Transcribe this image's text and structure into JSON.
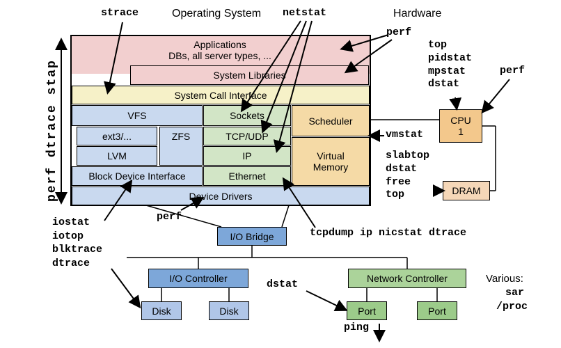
{
  "headers": {
    "os": "Operating System",
    "hardware": "Hardware"
  },
  "os_stack": {
    "apps_line1": "Applications",
    "apps_line2": "DBs, all server types, ...",
    "syslibs": "System Libraries",
    "syscall": "System Call Interface",
    "vfs": "VFS",
    "ext3": "ext3/...",
    "zfs": "ZFS",
    "lvm": "LVM",
    "bdi": "Block Device Interface",
    "sockets": "Sockets",
    "tcpudp": "TCP/UDP",
    "ip": "IP",
    "ethernet": "Ethernet",
    "scheduler": "Scheduler",
    "vmem_line1": "Virtual",
    "vmem_line2": "Memory",
    "device_drivers": "Device Drivers"
  },
  "hardware": {
    "cpu_label": "CPU",
    "cpu_num": "1",
    "dram": "DRAM",
    "iobridge": "I/O Bridge",
    "ioctrl": "I/O Controller",
    "netctrl": "Network Controller",
    "disk": "Disk",
    "port": "Port"
  },
  "tools": {
    "left_vertical": "perf dtrace stap",
    "strace": "strace",
    "netstat": "netstat",
    "perf_top": "perf",
    "top_right_lines": "top\npidstat\nmpstat\ndstat",
    "perf_right": "perf",
    "vmstat": "vmstat",
    "slabtop_lines": "slabtop\ndstat\nfree\ntop",
    "iostat_lines": "iostat\niotop\nblktrace\ndtrace",
    "perf_mid": "perf",
    "dstat": "dstat",
    "tcpdump_etc": "tcpdump ip nicstat dtrace",
    "ping": "ping",
    "various": "Various:",
    "sar": "sar",
    "proc": "/proc"
  }
}
